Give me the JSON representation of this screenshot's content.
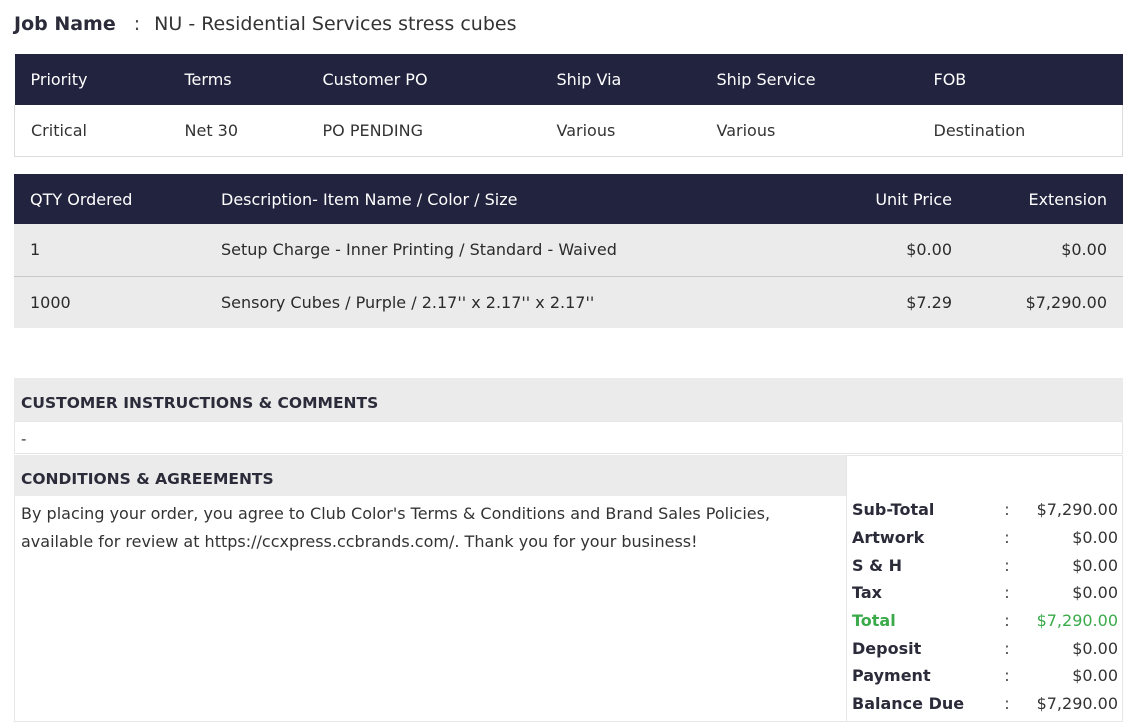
{
  "job": {
    "label": "Job Name",
    "separator": ":",
    "value": "NU - Residential Services stress cubes"
  },
  "order_info": {
    "headers": [
      "Priority",
      "Terms",
      "Customer PO",
      "Ship Via",
      "Ship Service",
      "FOB"
    ],
    "values": [
      "Critical",
      "Net 30",
      "PO PENDING",
      "Various",
      "Various",
      "Destination"
    ]
  },
  "items": {
    "headers": {
      "qty": "QTY Ordered",
      "description": "Description- Item Name / Color / Size",
      "unit_price": "Unit Price",
      "extension": "Extension"
    },
    "rows": [
      {
        "qty": "1",
        "description": "Setup Charge - Inner Printing / Standard - Waived",
        "unit_price": "$0.00",
        "extension": "$0.00"
      },
      {
        "qty": "1000",
        "description": "Sensory Cubes / Purple / 2.17'' x 2.17'' x 2.17''",
        "unit_price": "$7.29",
        "extension": "$7,290.00"
      }
    ]
  },
  "instructions": {
    "title": "CUSTOMER INSTRUCTIONS & COMMENTS",
    "text": "-"
  },
  "conditions": {
    "title": "CONDITIONS & AGREEMENTS",
    "text": "By placing your order, you agree to Club Color's Terms & Conditions and Brand Sales Policies, available for review at https://ccxpress.ccbrands.com/. Thank you for your business!"
  },
  "totals": {
    "separator": ":",
    "rows": [
      {
        "label": "Sub-Total",
        "value": "$7,290.00"
      },
      {
        "label": "Artwork",
        "value": "$0.00"
      },
      {
        "label": "S & H",
        "value": "$0.00"
      },
      {
        "label": "Tax",
        "value": "$0.00"
      },
      {
        "label": "Total",
        "value": "$7,290.00"
      },
      {
        "label": "Deposit",
        "value": "$0.00"
      },
      {
        "label": "Payment",
        "value": "$0.00"
      },
      {
        "label": "Balance Due",
        "value": "$7,290.00"
      }
    ]
  },
  "colors": {
    "header_bg": "#22233f",
    "row_bg": "#ebebeb",
    "total_accent": "#3aaa4a"
  }
}
